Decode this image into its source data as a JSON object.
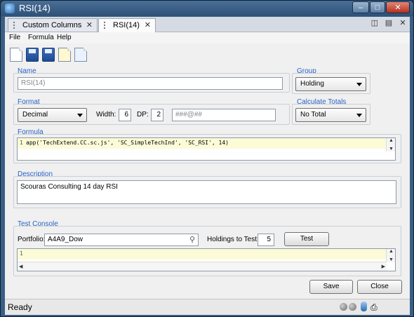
{
  "window": {
    "title": "RSI(14)"
  },
  "tabs": [
    {
      "label": "Custom Columns",
      "close": "✕"
    },
    {
      "label": "RSI(14)",
      "close": "✕"
    }
  ],
  "menu": {
    "file": "File",
    "formula": "Formula",
    "help": "Help"
  },
  "name_section": {
    "label": "Name",
    "value": "RSI(14)"
  },
  "group_section": {
    "label": "Group",
    "value": "Holding"
  },
  "format_section": {
    "label": "Format",
    "format_value": "Decimal",
    "width_label": "Width:",
    "width_value": "6",
    "dp_label": "DP:",
    "dp_value": "2",
    "mask_value": "###@##"
  },
  "totals_section": {
    "label": "Calculate Totals",
    "value": "No Total"
  },
  "formula_section": {
    "label": "Formula",
    "line_number": "1",
    "code": "app('TechExtend.CC.sc.js', 'SC_SimpleTechInd', 'SC_RSI', 14)"
  },
  "description_section": {
    "label": "Description",
    "value": "Scouras Consulting 14 day RSI"
  },
  "test_console": {
    "label": "Test Console",
    "portfolio_label": "Portfolio:",
    "portfolio_value": "A4A9_Dow",
    "holdings_label": "Holdings to Test:",
    "holdings_value": "5",
    "test_button": "Test",
    "line_number": "1"
  },
  "buttons": {
    "save": "Save",
    "close": "Close"
  },
  "status": {
    "text": "Ready"
  },
  "accent_color": "#2a63c8"
}
